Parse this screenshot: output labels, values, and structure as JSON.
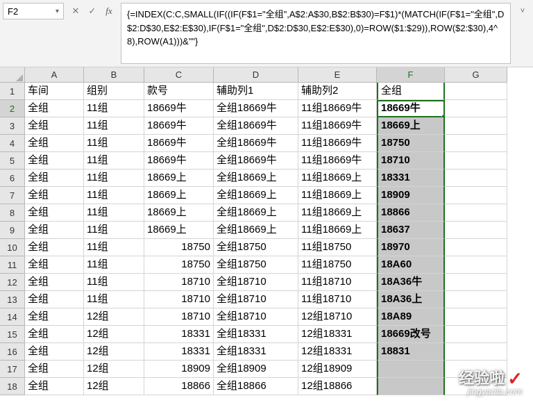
{
  "namebox": {
    "value": "F2"
  },
  "formula": "{=INDEX(C:C,SMALL(IF((IF(F$1=\"全组\",A$2:A$30,B$2:B$30)=F$1)*(MATCH(IF(F$1=\"全组\",D$2:D$30,E$2:E$30),IF(F$1=\"全组\",D$2:D$30,E$2:E$30),0)=ROW($1:$29)),ROW($2:$30),4^8),ROW(A1)))&\"\"}",
  "icons": {
    "fx": "fx",
    "check": "✓",
    "cross": "✕",
    "namebox_arrow": "▾",
    "expand": "˅"
  },
  "columns": [
    "A",
    "B",
    "C",
    "D",
    "E",
    "F",
    "G"
  ],
  "headers": {
    "A": "车间",
    "B": "组别",
    "C": "款号",
    "D": "辅助列1",
    "E": "辅助列2",
    "F": "全组",
    "G": ""
  },
  "rows": [
    {
      "n": 2,
      "A": "全组",
      "B": "11组",
      "C": "18669牛",
      "D": "全组18669牛",
      "E": "11组18669牛",
      "F": "18669牛"
    },
    {
      "n": 3,
      "A": "全组",
      "B": "11组",
      "C": "18669牛",
      "D": "全组18669牛",
      "E": "11组18669牛",
      "F": "18669上"
    },
    {
      "n": 4,
      "A": "全组",
      "B": "11组",
      "C": "18669牛",
      "D": "全组18669牛",
      "E": "11组18669牛",
      "F": "18750"
    },
    {
      "n": 5,
      "A": "全组",
      "B": "11组",
      "C": "18669牛",
      "D": "全组18669牛",
      "E": "11组18669牛",
      "F": "18710"
    },
    {
      "n": 6,
      "A": "全组",
      "B": "11组",
      "C": "18669上",
      "D": "全组18669上",
      "E": "11组18669上",
      "F": "18331"
    },
    {
      "n": 7,
      "A": "全组",
      "B": "11组",
      "C": "18669上",
      "D": "全组18669上",
      "E": "11组18669上",
      "F": "18909"
    },
    {
      "n": 8,
      "A": "全组",
      "B": "11组",
      "C": "18669上",
      "D": "全组18669上",
      "E": "11组18669上",
      "F": "18866"
    },
    {
      "n": 9,
      "A": "全组",
      "B": "11组",
      "C": "18669上",
      "D": "全组18669上",
      "E": "11组18669上",
      "F": "18637"
    },
    {
      "n": 10,
      "A": "全组",
      "B": "11组",
      "C": "18750",
      "Cnum": true,
      "D": "全组18750",
      "E": "11组18750",
      "F": "18970"
    },
    {
      "n": 11,
      "A": "全组",
      "B": "11组",
      "C": "18750",
      "Cnum": true,
      "D": "全组18750",
      "E": "11组18750",
      "F": "18A60"
    },
    {
      "n": 12,
      "A": "全组",
      "B": "11组",
      "C": "18710",
      "Cnum": true,
      "D": "全组18710",
      "E": "11组18710",
      "F": "18A36牛"
    },
    {
      "n": 13,
      "A": "全组",
      "B": "11组",
      "C": "18710",
      "Cnum": true,
      "D": "全组18710",
      "E": "11组18710",
      "F": "18A36上"
    },
    {
      "n": 14,
      "A": "全组",
      "B": "12组",
      "C": "18710",
      "Cnum": true,
      "D": "全组18710",
      "E": "12组18710",
      "F": "18A89"
    },
    {
      "n": 15,
      "A": "全组",
      "B": "12组",
      "C": "18331",
      "Cnum": true,
      "D": "全组18331",
      "E": "12组18331",
      "F": "18669改号"
    },
    {
      "n": 16,
      "A": "全组",
      "B": "12组",
      "C": "18331",
      "Cnum": true,
      "D": "全组18331",
      "E": "12组18331",
      "F": "18831"
    },
    {
      "n": 17,
      "A": "全组",
      "B": "12组",
      "C": "18909",
      "Cnum": true,
      "D": "全组18909",
      "E": "12组18909",
      "F": ""
    },
    {
      "n": 18,
      "A": "全组",
      "B": "12组",
      "C": "18866",
      "Cnum": true,
      "D": "全组18866",
      "E": "12组18866",
      "F": ""
    }
  ],
  "watermark": {
    "text": "经验啦",
    "url": "jingyanla.com"
  }
}
